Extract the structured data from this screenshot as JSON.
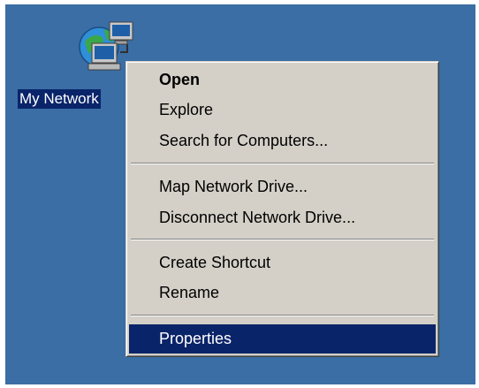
{
  "desktop": {
    "background": "#3a6ea5",
    "icon": {
      "name": "my-network-places-icon",
      "label": "My Network"
    }
  },
  "context_menu": {
    "items": [
      {
        "label": "Open",
        "default": true
      },
      {
        "label": "Explore"
      },
      {
        "label": "Search for Computers..."
      },
      {
        "label": "Map Network Drive..."
      },
      {
        "label": "Disconnect Network Drive..."
      },
      {
        "label": "Create Shortcut"
      },
      {
        "label": "Rename"
      },
      {
        "label": "Properties",
        "selected": true
      }
    ],
    "selection_color": "#0a246a"
  }
}
